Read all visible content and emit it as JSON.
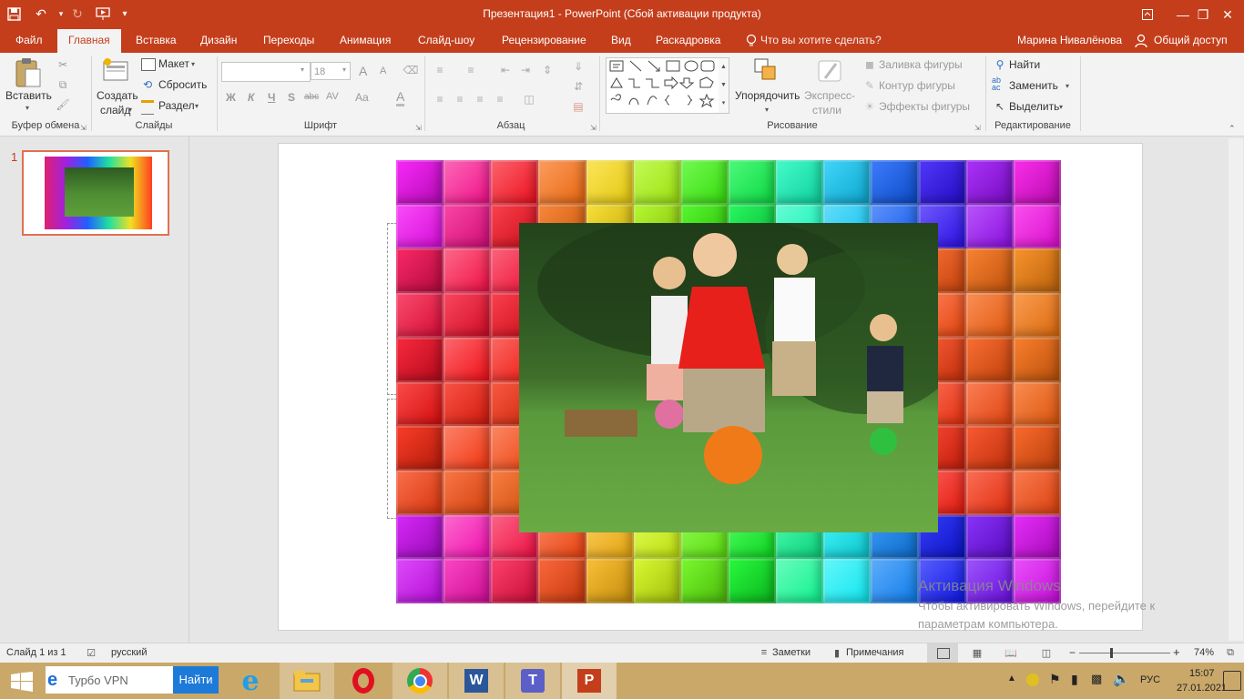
{
  "app": {
    "title": "Презентация1 - PowerPoint (Сбой активации продукта)",
    "colors": {
      "accent": "#c43e1c",
      "ribbon": "#f3f3f3",
      "taskbar": "#c9a86a"
    }
  },
  "tabs": [
    "Файл",
    "Главная",
    "Вставка",
    "Дизайн",
    "Переходы",
    "Анимация",
    "Слайд-шоу",
    "Рецензирование",
    "Вид",
    "Раскадровка"
  ],
  "tell_me": "Что вы хотите сделать?",
  "user": "Марина Нивалёнова",
  "share": "Общий доступ",
  "ribbon": {
    "clipboard": {
      "paste": "Вставить",
      "label": "Буфер обмена"
    },
    "slides": {
      "new_slide_1": "Создать",
      "new_slide_2": "слайд",
      "layout": "Макет",
      "reset": "Сбросить",
      "section": "Раздел",
      "label": "Слайды"
    },
    "font": {
      "name": "",
      "size": "18",
      "bold": "Ж",
      "italic": "К",
      "underline": "Ч",
      "shadow": "S",
      "strike": "abc",
      "spacing": "AV",
      "case": "Aa",
      "color": "A",
      "grow": "A",
      "shrink": "A",
      "label": "Шрифт"
    },
    "paragraph": {
      "label": "Абзац"
    },
    "drawing": {
      "arrange": "Упорядочить",
      "styles_1": "Экспресс-",
      "styles_2": "стили",
      "fill": "Заливка фигуры",
      "outline": "Контур фигуры",
      "effects": "Эффекты фигуры",
      "label": "Рисование"
    },
    "editing": {
      "find": "Найти",
      "replace": "Заменить",
      "select": "Выделить",
      "label": "Редактирование"
    }
  },
  "thumbnail": {
    "number": "1"
  },
  "watermark": {
    "line1": "Активация Windows",
    "line2": "Чтобы активировать Windows, перейдите к",
    "line3": "параметрам компьютера."
  },
  "status": {
    "slide": "Слайд 1 из 1",
    "language": "русский",
    "notes": "Заметки",
    "comments": "Примечания",
    "zoom": "74%",
    "zoom_level": 0.74
  },
  "taskbar": {
    "search_text": "Турбо VPN",
    "search_button": "Найти",
    "lang": "РУС",
    "time": "15:07",
    "date": "27.01.2021"
  }
}
